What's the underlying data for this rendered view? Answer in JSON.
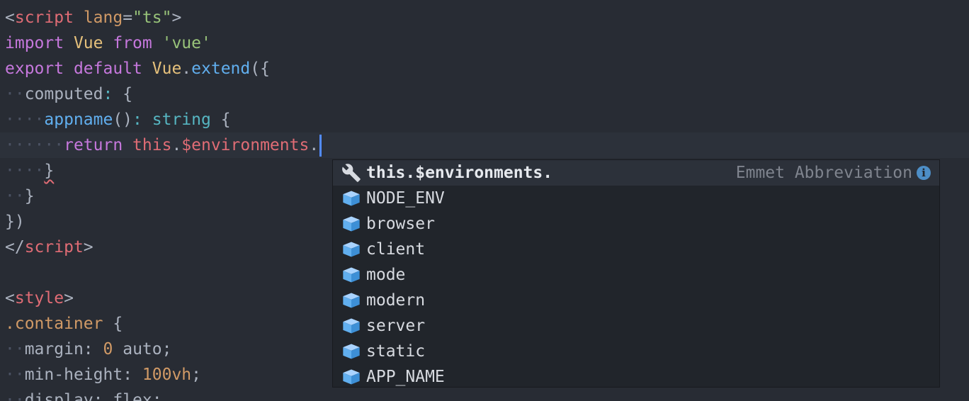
{
  "editor": {
    "lines": [
      {
        "tokens": [
          [
            "t-punc",
            "<"
          ],
          [
            "t-tag",
            "script"
          ],
          [
            "t-plain",
            " "
          ],
          [
            "t-attr",
            "lang"
          ],
          [
            "t-punc",
            "="
          ],
          [
            "t-str",
            "\"ts\""
          ],
          [
            "t-punc",
            ">"
          ]
        ]
      },
      {
        "tokens": [
          [
            "t-kw",
            "import"
          ],
          [
            "t-plain",
            " "
          ],
          [
            "t-cls",
            "Vue"
          ],
          [
            "t-plain",
            " "
          ],
          [
            "t-kw",
            "from"
          ],
          [
            "t-plain",
            " "
          ],
          [
            "t-str",
            "'vue'"
          ]
        ]
      },
      {
        "tokens": [
          [
            "t-kw",
            "export"
          ],
          [
            "t-plain",
            " "
          ],
          [
            "t-kw",
            "default"
          ],
          [
            "t-plain",
            " "
          ],
          [
            "t-cls",
            "Vue"
          ],
          [
            "t-punc",
            "."
          ],
          [
            "t-fn",
            "extend"
          ],
          [
            "t-punc",
            "({"
          ]
        ]
      },
      {
        "tokens": [
          [
            "ws",
            "··"
          ],
          [
            "t-plain",
            "computed"
          ],
          [
            "t-op",
            ":"
          ],
          [
            "t-plain",
            " "
          ],
          [
            "t-punc",
            "{"
          ]
        ]
      },
      {
        "tokens": [
          [
            "ws",
            "····"
          ],
          [
            "t-fn",
            "appname"
          ],
          [
            "t-punc",
            "()"
          ],
          [
            "t-op",
            ":"
          ],
          [
            "t-plain",
            " "
          ],
          [
            "t-type",
            "string"
          ],
          [
            "t-plain",
            " "
          ],
          [
            "t-punc",
            "{"
          ]
        ]
      },
      {
        "current": true,
        "tokens": [
          [
            "ws",
            "······"
          ],
          [
            "t-kw",
            "return"
          ],
          [
            "t-plain",
            " "
          ],
          [
            "t-prop",
            "this"
          ],
          [
            "t-punc",
            "."
          ],
          [
            "t-prop",
            "$environments"
          ],
          [
            "t-punc",
            "."
          ]
        ]
      },
      {
        "tokens": [
          [
            "ws",
            "····"
          ],
          [
            "squiggle",
            "}"
          ]
        ]
      },
      {
        "tokens": [
          [
            "ws",
            "··"
          ],
          [
            "t-punc",
            "}"
          ]
        ]
      },
      {
        "tokens": [
          [
            "t-punc",
            "})"
          ]
        ]
      },
      {
        "tokens": [
          [
            "t-punc",
            "</"
          ],
          [
            "t-tag",
            "script"
          ],
          [
            "t-punc",
            ">"
          ]
        ]
      },
      {
        "tokens": []
      },
      {
        "tokens": [
          [
            "t-punc",
            "<"
          ],
          [
            "t-tag",
            "style"
          ],
          [
            "t-punc",
            ">"
          ]
        ]
      },
      {
        "tokens": [
          [
            "t-attr",
            ".container"
          ],
          [
            "t-plain",
            " "
          ],
          [
            "t-punc",
            "{"
          ]
        ]
      },
      {
        "tokens": [
          [
            "ws",
            "··"
          ],
          [
            "t-plain",
            "margin"
          ],
          [
            "t-punc",
            ":"
          ],
          [
            "t-plain",
            " "
          ],
          [
            "t-num",
            "0"
          ],
          [
            "t-plain",
            " auto"
          ],
          [
            "t-punc",
            ";"
          ]
        ]
      },
      {
        "tokens": [
          [
            "ws",
            "··"
          ],
          [
            "t-plain",
            "min-height"
          ],
          [
            "t-punc",
            ":"
          ],
          [
            "t-plain",
            " "
          ],
          [
            "t-num",
            "100vh"
          ],
          [
            "t-punc",
            ";"
          ]
        ]
      },
      {
        "tokens": [
          [
            "ws",
            "··"
          ],
          [
            "t-plain",
            "display"
          ],
          [
            "t-punc",
            ":"
          ],
          [
            "t-plain",
            " flex"
          ],
          [
            "t-punc",
            ";"
          ]
        ]
      }
    ]
  },
  "autocomplete": {
    "items": [
      {
        "label": "this.$environments.",
        "kind": "snippet",
        "icon": "wrench-icon",
        "right_label": "Emmet Abbreviation",
        "selected": true
      },
      {
        "label": "NODE_ENV",
        "kind": "property",
        "icon": "cube-icon"
      },
      {
        "label": "browser",
        "kind": "property",
        "icon": "cube-icon"
      },
      {
        "label": "client",
        "kind": "property",
        "icon": "cube-icon"
      },
      {
        "label": "mode",
        "kind": "property",
        "icon": "cube-icon"
      },
      {
        "label": "modern",
        "kind": "property",
        "icon": "cube-icon"
      },
      {
        "label": "server",
        "kind": "property",
        "icon": "cube-icon"
      },
      {
        "label": "static",
        "kind": "property",
        "icon": "cube-icon"
      },
      {
        "label": "APP_NAME",
        "kind": "property",
        "icon": "cube-icon"
      }
    ],
    "info_icon": "i"
  },
  "colors": {
    "background": "#282c34",
    "popup_background": "#21252b",
    "cursor": "#528bff",
    "cube_icon": "#61afef"
  }
}
